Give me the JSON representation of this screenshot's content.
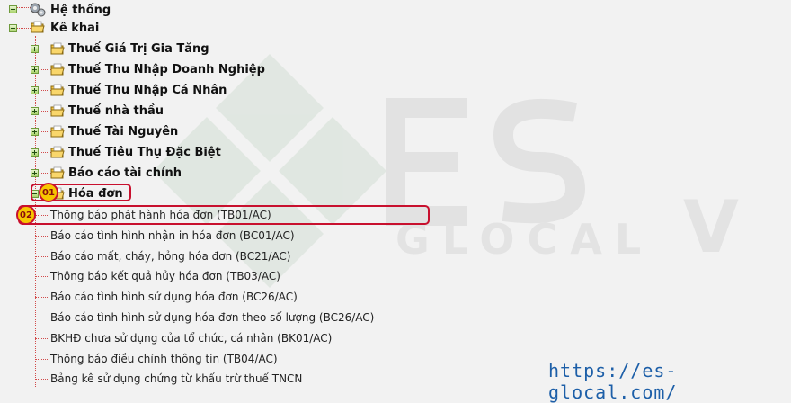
{
  "tree": {
    "root": [
      {
        "label": "Hệ thống",
        "icon": "gears-icon"
      },
      {
        "label": "Kê khai",
        "icon": "folder-icon"
      }
    ],
    "groups": [
      {
        "label": "Thuế Giá Trị Gia Tăng"
      },
      {
        "label": "Thuế Thu Nhập Doanh Nghiệp"
      },
      {
        "label": "Thuế Thu Nhập Cá Nhân"
      },
      {
        "label": "Thuế nhà thầu"
      },
      {
        "label": "Thuế Tài Nguyên"
      },
      {
        "label": "Thuế Tiêu Thụ Đặc Biệt"
      },
      {
        "label": "Báo cáo tài chính"
      },
      {
        "label": "Hóa đơn"
      }
    ],
    "leaves": [
      {
        "label": "Thông báo phát hành hóa đơn (TB01/AC)"
      },
      {
        "label": "Báo cáo tình hình nhận in hóa đơn (BC01/AC)"
      },
      {
        "label": "Báo cáo mất, cháy, hỏng hóa đơn (BC21/AC)"
      },
      {
        "label": "Thông báo kết quả hủy hóa đơn (TB03/AC)"
      },
      {
        "label": "Báo cáo tình hình sử dụng hóa đơn (BC26/AC)"
      },
      {
        "label": "Báo cáo tình hình sử dụng hóa đơn theo số lượng (BC26/AC)"
      },
      {
        "label": "BKHĐ chưa sử dụng của tổ chức, cá nhân (BK01/AC)"
      },
      {
        "label": "Thông báo điều chỉnh thông tin (TB04/AC)"
      },
      {
        "label": "Bảng kê sử dụng chứng từ khấu trừ thuế TNCN"
      }
    ]
  },
  "annotations": {
    "badge1": "01",
    "badge2": "02"
  },
  "watermark": {
    "brand": "ES",
    "sub": "GLOCAL",
    "url": "https://es-glocal.com/"
  },
  "colors": {
    "accent_red": "#c8102e",
    "badge_yellow": "#f7c600",
    "tree_line": "#d24b4b",
    "url_blue": "#1d5fa8"
  }
}
